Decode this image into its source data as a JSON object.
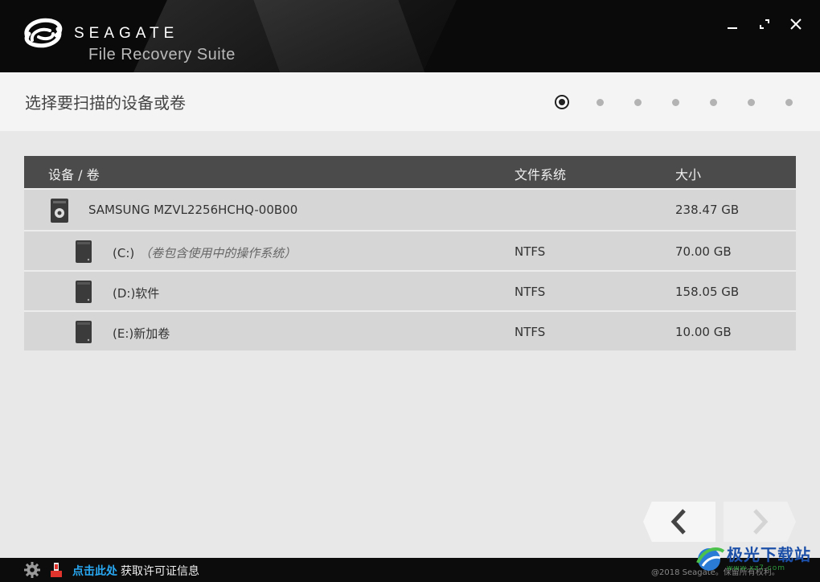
{
  "header": {
    "brand": "SEAGATE",
    "product": "File Recovery Suite",
    "controls": [
      "minimize-icon",
      "maximize-icon",
      "close-icon"
    ]
  },
  "titlebar": {
    "title": "选择要扫描的设备或卷",
    "steps_total": 7,
    "steps_active": 1
  },
  "table": {
    "columns": [
      "设备 / 卷",
      "文件系统",
      "大小"
    ],
    "rows": [
      {
        "type": "disk",
        "name": "SAMSUNG MZVL2256HCHQ-00B00",
        "note": "",
        "fs": "",
        "size": "238.47 GB",
        "icon": "hard-disk-icon"
      },
      {
        "type": "volume",
        "name": "(C:)",
        "note": "（卷包含使用中的操作系统）",
        "fs": "NTFS",
        "size": "70.00 GB",
        "icon": "volume-icon"
      },
      {
        "type": "volume",
        "name": "(D:)软件",
        "note": "",
        "fs": "NTFS",
        "size": "158.05 GB",
        "icon": "volume-icon"
      },
      {
        "type": "volume",
        "name": "(E:)新加卷",
        "note": "",
        "fs": "NTFS",
        "size": "10.00 GB",
        "icon": "volume-icon"
      }
    ]
  },
  "nav": {
    "back_icon": "chevron-left-icon",
    "next_icon": "chevron-right-icon"
  },
  "footer": {
    "link": "点击此处",
    "license_text": "获取许可证信息",
    "copyright": "@2018 Seagate。保留所有权利。"
  },
  "watermark": {
    "text": "极光下载站",
    "sub": "www.xz7.com"
  },
  "colors": {
    "header_bg": "#0a0a0a",
    "table_head": "#4b4b4b",
    "row_bg": "#d6d6d6",
    "link": "#29a8f2"
  }
}
